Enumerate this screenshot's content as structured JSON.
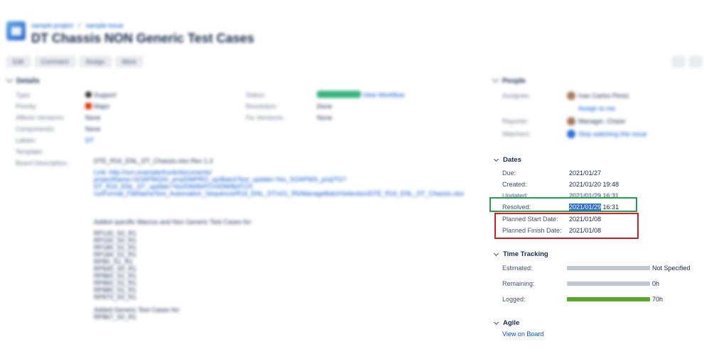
{
  "header": {
    "breadcrumb": [
      "sample-project",
      "sample-issue"
    ],
    "title": "DT Chassis NON Generic Test Cases"
  },
  "toolbar": {
    "buttons": [
      "Edit",
      "Comment",
      "Assign",
      "More"
    ]
  },
  "details": {
    "section_title": "Details",
    "labels": [
      "Type:",
      "Priority:",
      "Affects Version/s:",
      "Component/s:",
      "Labels:",
      "Template:",
      "Board Description:"
    ],
    "values": [
      "Support",
      "Major",
      "None",
      "None",
      "DT",
      "",
      ""
    ],
    "mid_labels": [
      "Status:",
      "Resolution:",
      "Fix Version/s:"
    ],
    "mid_values": [
      "",
      "Done",
      "None"
    ],
    "workflow_link": "View Workflow"
  },
  "description": {
    "first": "DTE_R16_ENL_DT_Chassis.xlsx Rev 1.3",
    "link_lines": [
      "Link: http://svn.example/trunk/documents/",
      "projectName=SOAPWQS/_proj/DMPRO_up/BatchTest_update=Yes_SOAPWS_proj/TG?DT_R16_ENL_DT_update=Yes/DM/BATCH/DM/BATCH",
      "runFormat_FileNameTest_Automation_Sequence/R16_ENL_DT/v01_R5/ManageBatchSelection/DTE_R16_ENL_DT_Chassis.xlsx"
    ],
    "list_title": "Added specific Macros and Non Generic Test Cases for:",
    "list_items": [
      "RP130_S0_R1",
      "RP150_S0_R1",
      "RP180_S1_R1",
      "RP184_S1_R1",
      "RP80_S1_R1",
      "RP840_S0_R1",
      "RP860_S1_R1",
      "RP860_S1_R1",
      "RP880_S1_R1",
      "RP870_S0_R1"
    ],
    "list_title_2": "Added Generic Test Cases for:",
    "list_items_2": [
      "RP867_S0_R1"
    ]
  },
  "people": {
    "section_title": "People",
    "labels": [
      "Assignee:",
      "",
      "Reporter:",
      "Watchers:"
    ],
    "values": [
      "Ivan Carlos Perez",
      "Assign to me",
      "Manager, Chase",
      "Stop watching this issue"
    ]
  },
  "dates": {
    "section_title": "Dates",
    "rows": [
      {
        "label": "Due:",
        "value": "2021/01/27"
      },
      {
        "label": "Created:",
        "value": "2021/01/20 19:48"
      },
      {
        "label": "Updated:",
        "value": "2021/01/29 16:31"
      },
      {
        "label": "Resolved:",
        "value_highlight": "2021/01/29",
        "value_rest": " 16:31"
      },
      {
        "label": "Planned Start Date:",
        "value": "2021/01/08"
      },
      {
        "label": "Planned Finish Date:",
        "value": "2021/01/08"
      }
    ]
  },
  "time_tracking": {
    "section_title": "Time Tracking",
    "rows": [
      {
        "label": "Estimated:",
        "value": "Not Specified",
        "fill": 0,
        "color": "#c1c7d0"
      },
      {
        "label": "Remaining:",
        "value": "0h",
        "fill": 0,
        "color": "#c1c7d0"
      },
      {
        "label": "Logged:",
        "value": "70h",
        "fill": 1,
        "color": "#5aa829"
      }
    ]
  },
  "agile": {
    "section_title": "Agile",
    "link": "View on Board"
  },
  "colors": {
    "accent": "#0052cc",
    "green_box": "#1fa34a",
    "red_box": "#d81e24",
    "selection": "#2b6ed6"
  }
}
